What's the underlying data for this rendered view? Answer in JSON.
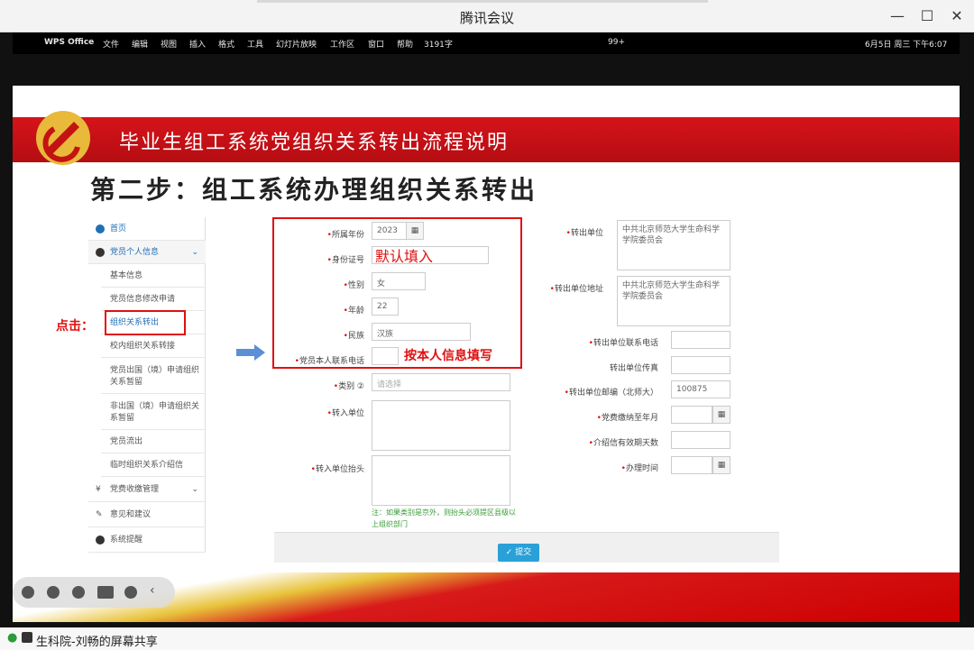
{
  "window": {
    "title": "腾讯会议"
  },
  "macbar": {
    "apple": "",
    "app": "WPS Office",
    "menus": [
      "文件",
      "编辑",
      "视图",
      "插入",
      "格式",
      "工具",
      "幻灯片放映",
      "工作区",
      "窗口",
      "帮助"
    ],
    "word_count": "3191字",
    "notif": "99+",
    "clock": "6月5日 周三 下午6:07"
  },
  "slide": {
    "banner_title": "毕业生组工系统党组织关系转出流程说明",
    "step_title": "第二步：组工系统办理组织关系转出"
  },
  "nav": {
    "home": "首页",
    "personal": "党员个人信息",
    "subs": [
      "基本信息",
      "党员信息修改申请",
      "组织关系转出",
      "校内组织关系转接",
      "党员出国（境）申请组织关系暂留",
      "非出国（境）申请组织关系暂留",
      "党员流出",
      "临时组织关系介绍信"
    ],
    "fees": "党费收缴管理",
    "feedback": "意见和建议",
    "reminder": "系统提醒",
    "click_label": "点击："
  },
  "form": {
    "year_label": "所属年份",
    "year_value": "2023",
    "id_label": "身份证号",
    "id_value": "默认填入",
    "sex_label": "性别",
    "sex_value": "女",
    "age_label": "年龄",
    "age_value": "22",
    "ethnic_label": "民族",
    "ethnic_value": "汉族",
    "phone_label": "党员本人联系电话",
    "category_label": "类别 ②",
    "category_placeholder": "请选择",
    "to_unit_label": "转入单位",
    "to_header_label": "转入单位抬头",
    "note": "注：如果类别是京外，则抬头必须提区县级以上组织部门",
    "fill_note": "按本人信息填写",
    "from_unit_label": "转出单位",
    "from_unit_value": "中共北京师范大学生命科学学院委员会",
    "from_addr_label": "转出单位地址",
    "from_addr_value": "中共北京师范大学生命科学学院委员会",
    "from_phone_label": "转出单位联系电话",
    "from_fax_label": "转出单位传真",
    "from_zip_label": "转出单位邮编（北师大）",
    "from_zip_value": "100875",
    "fee_label": "党费缴纳至年月",
    "letter_label": "介绍信有效期天数",
    "date_label": "办理时间",
    "submit": "提交"
  },
  "footer": {
    "share": "生科院-刘畅的屏幕共享"
  }
}
